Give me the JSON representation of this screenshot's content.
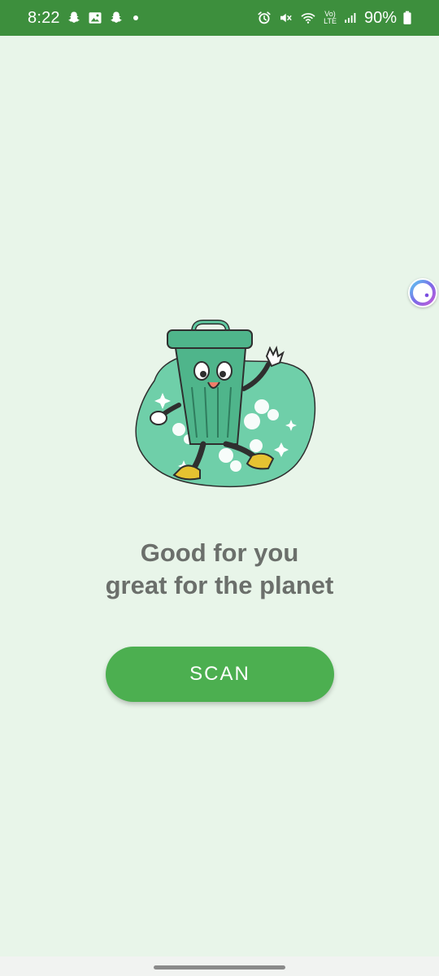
{
  "status_bar": {
    "time": "8:22",
    "left_icons": [
      "snapchat-icon",
      "gallery-icon",
      "snapchat-icon",
      "dot-icon"
    ],
    "right_icons": [
      "alarm-icon",
      "mute-icon",
      "wifi-icon",
      "volte-icon",
      "signal-icon",
      "battery-icon"
    ],
    "volte_label_top": "Vo)",
    "volte_label_bottom": "LTE",
    "battery": "90%",
    "color": "#3d8f3d"
  },
  "main": {
    "tagline_line1": "Good for you",
    "tagline_line2": "great for the planet",
    "scan_label": "SCAN",
    "accent": "#4caf50",
    "background": "#e8f5e9"
  },
  "illustration": {
    "icon": "walking-trash-can-icon"
  },
  "assistant": {
    "icon": "assistant-bubble-icon"
  }
}
